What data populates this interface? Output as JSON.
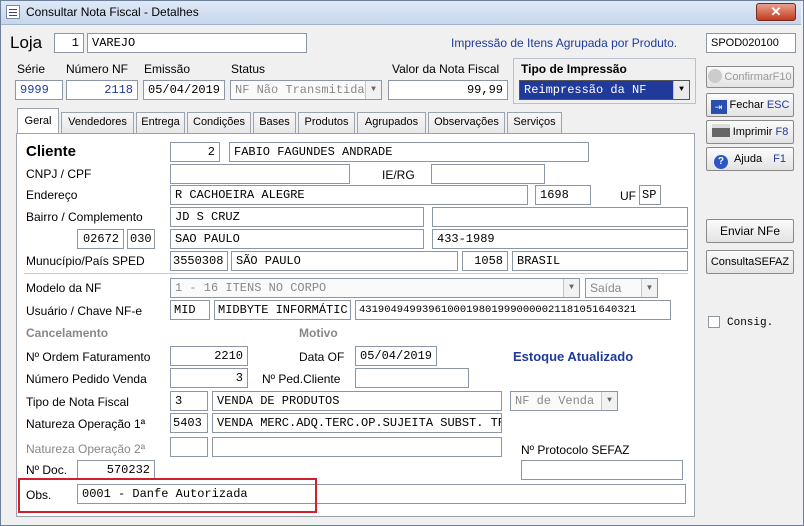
{
  "window": {
    "title": "Consultar Nota Fiscal - Detalhes",
    "close": "✕"
  },
  "header": {
    "loja_label": "Loja",
    "loja_num": "1",
    "loja_name": "VAREJO",
    "info": "Impressão de Itens Agrupada por Produto.",
    "code": "SPOD020100"
  },
  "top": {
    "serie_label": "Série",
    "serie": "9999",
    "numero_label": "Número NF",
    "numero": "2118",
    "emissao_label": "Emissão",
    "emissao": "05/04/2019",
    "status_label": "Status",
    "status": "NF Não Transmitida",
    "valor_label": "Valor da Nota Fiscal",
    "valor": "99,99",
    "tipo_label": "Tipo de Impressão",
    "tipo": "Reimpressão da  NF"
  },
  "buttons": {
    "confirmar": "ConfirmarF10",
    "fechar": "Fechar",
    "fechar_key": "ESC",
    "imprimir": "Imprimir",
    "imprimir_key": "F8",
    "ajuda": "Ajuda",
    "ajuda_key": "F1",
    "enviar": "Enviar NFe",
    "consulta": "ConsultaSEFAZ"
  },
  "consig": "Consig.",
  "tabs": [
    "Geral",
    "Vendedores",
    "Entrega",
    "Condições",
    "Bases",
    "Produtos",
    "Agrupados",
    "Observações",
    "Serviços"
  ],
  "form": {
    "cliente_label": "Cliente",
    "cliente_num": "2",
    "cliente_name": "FABIO FAGUNDES ANDRADE",
    "cnpj_label": "CNPJ / CPF",
    "cnpj": "",
    "ie_label": "IE/RG",
    "ie": "",
    "endereco_label": "Endereço",
    "endereco": "R CACHOEIRA ALEGRE",
    "numero": "1698",
    "uf_label": "UF",
    "uf": "SP",
    "bairro_label": "Bairro / Complemento",
    "bairro": "JD S CRUZ",
    "complemento": "",
    "cep1": "02672",
    "cep2": "030",
    "cidade": "SAO PAULO",
    "fone": "433-1989",
    "municipio_label": "Munucípio/País SPED",
    "mun_code": "3550308",
    "mun_name": "SÃO PAULO",
    "pais_code": "1058",
    "pais_name": "BRASIL",
    "modelo_label": "Modelo da NF",
    "modelo": "1 - 16 ITENS NO CORPO",
    "saida": "Saída",
    "usuario_label": "Usuário / Chave NF-e",
    "usuario": "MID",
    "usuario_name": "MIDBYTE INFORMÁTIC.",
    "chave": "43190494993961000198019990000021181051640321",
    "cancelamento_label": "Cancelamento",
    "motivo_label": "Motivo",
    "ordem_label": "Nº Ordem Faturamento",
    "ordem": "2210",
    "dataof_label": "Data OF",
    "dataof": "05/04/2019",
    "estoque": "Estoque Atualizado",
    "pedido_label": "Número Pedido Venda",
    "pedido": "3",
    "pedcli_label": "Nº Ped.Cliente",
    "pedcli": "",
    "tiponf_label": "Tipo de Nota Fiscal",
    "tiponf": "3",
    "tiponf_name": "VENDA DE PRODUTOS",
    "nfvenda": "NF de Venda",
    "nat1_label": "Natureza Operação 1ª",
    "nat1": "5403",
    "nat1_name": "VENDA MERC.ADQ.TERC.OP.SUJEITA SUBST. TR",
    "nat2_label": "Natureza Operação 2ª",
    "protocolo_label": "Nº Protocolo SEFAZ",
    "doc_label": "Nº Doc.",
    "doc": "570232",
    "obs_label": "Obs.",
    "obs": "0001 - Danfe Autorizada"
  }
}
